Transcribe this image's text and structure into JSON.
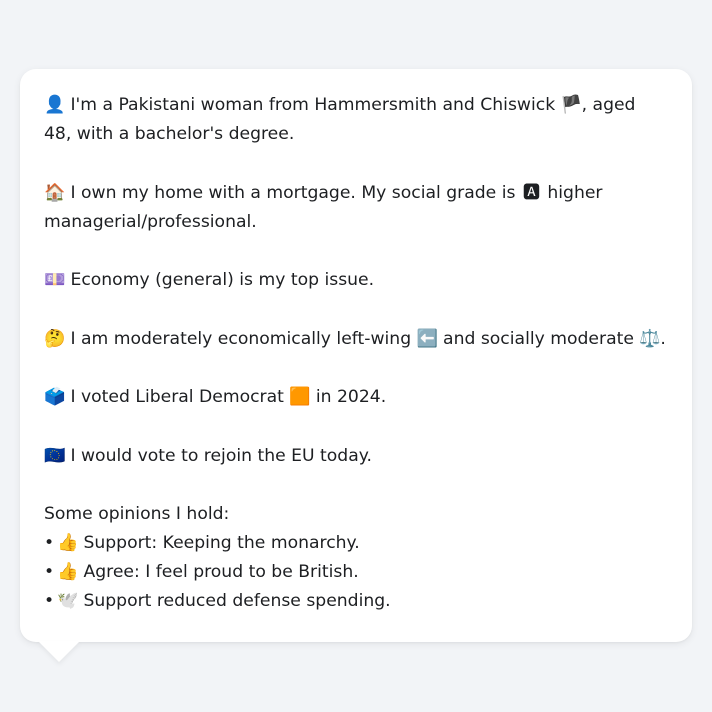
{
  "bubble": {
    "paragraphs": [
      {
        "icon": "👤",
        "icon_name": "person-silhouette-icon",
        "text_before": " I'm a Pakistani woman from Hammersmith and Chiswick ",
        "flag": "🏴",
        "flag_name": "england-flag-icon",
        "text_after": ", aged 48, with a bachelor's degree."
      },
      {
        "icon": "🏠",
        "icon_name": "house-icon",
        "text_before": " I own my home with a mortgage. My social grade is ",
        "badge": "🅰",
        "badge_name": "letter-a-badge-icon",
        "text_after": " higher managerial/professional."
      },
      {
        "icon": "💷",
        "icon_name": "banknote-icon",
        "text": " Economy (general) is my top issue."
      },
      {
        "icon": "🤔",
        "icon_name": "thinking-face-icon",
        "text_before": " I am moderately economically left-wing ",
        "mid_icon": "⬅️",
        "mid_icon_name": "left-arrow-icon",
        "text_middle": " and socially moderate ",
        "end_icon": "⚖️",
        "end_icon_name": "balance-scale-icon",
        "text_after": "."
      },
      {
        "icon": "🗳️",
        "icon_name": "ballot-box-icon",
        "text_before": " I voted Liberal Democrat ",
        "party_icon": "🟧",
        "party_icon_name": "orange-square-icon",
        "text_after": " in 2024."
      },
      {
        "icon": "🇪🇺",
        "icon_name": "eu-flag-icon",
        "text": " I would vote to rejoin the EU today."
      }
    ],
    "opinions_heading": "Some opinions I hold:",
    "opinions": [
      {
        "bullet": "•",
        "icon": "👍",
        "icon_name": "thumbs-up-icon",
        "text": " Support: Keeping the monarchy."
      },
      {
        "bullet": "•",
        "icon": "👍",
        "icon_name": "thumbs-up-icon",
        "text": " Agree: I feel proud to be British."
      },
      {
        "bullet": "•",
        "icon": "🕊️",
        "icon_name": "dove-icon",
        "text": " Support reduced defense spending."
      }
    ]
  }
}
